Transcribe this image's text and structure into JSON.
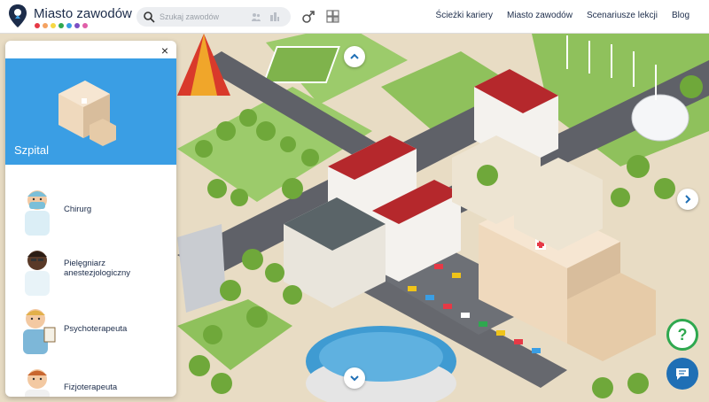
{
  "header": {
    "app_name": "Miasto zawodów",
    "logo_dot_colors": [
      "#e63946",
      "#f4a261",
      "#f6d743",
      "#2fa84f",
      "#3a9ee4",
      "#7b4fc4",
      "#e05fa8"
    ],
    "search": {
      "placeholder": "Szukaj zawodów"
    },
    "nav": [
      {
        "label": "Ścieżki kariery"
      },
      {
        "label": "Miasto zawodów"
      },
      {
        "label": "Scenariusze lekcji"
      },
      {
        "label": "Blog"
      }
    ]
  },
  "panel": {
    "title": "Szpital",
    "header_color": "#3a9ee4",
    "jobs": [
      {
        "label": "Chirurg"
      },
      {
        "label": "Pielęgniarz anestezjologiczny"
      },
      {
        "label": "Psychoterapeuta"
      },
      {
        "label": "Fizjoterapeuta"
      }
    ]
  },
  "buttons": {
    "help_label": "?"
  },
  "colors": {
    "accent": "#3a9ee4",
    "help_green": "#2fa84f",
    "chat_blue": "#1f6fb5"
  }
}
